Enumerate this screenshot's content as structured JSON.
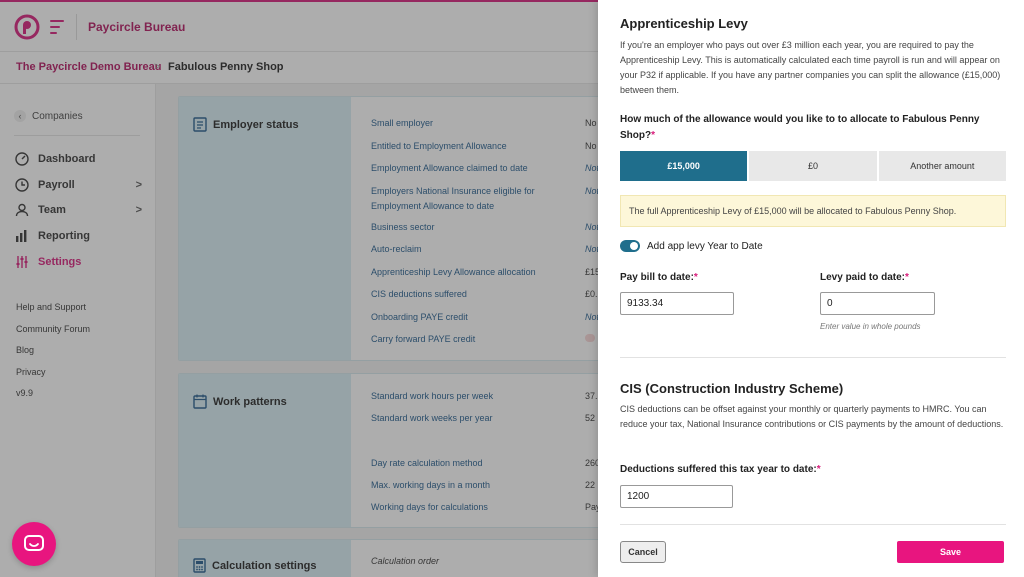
{
  "app": {
    "name": "Paycircle Bureau",
    "brand_color": "#d81b7a",
    "logo_icon": "paycircle-logo",
    "menu_icon": "hamburger-menu-icon"
  },
  "breadcrumb": {
    "parent": "The Paycircle Demo Bureau",
    "separator": ">",
    "current": "Fabulous Penny Shop"
  },
  "sidebar": {
    "back_label": "Companies",
    "items": [
      {
        "label": "Dashboard",
        "icon": "gauge-icon",
        "chevron": ""
      },
      {
        "label": "Payroll",
        "icon": "clock-icon",
        "chevron": ">"
      },
      {
        "label": "Team",
        "icon": "person-icon",
        "chevron": ">"
      },
      {
        "label": "Reporting",
        "icon": "bar-chart-icon",
        "chevron": ""
      },
      {
        "label": "Settings",
        "icon": "sliders-icon",
        "chevron": ""
      }
    ],
    "links": [
      "Help and Support",
      "Community Forum",
      "Blog",
      "Privacy",
      "v9.9"
    ]
  },
  "employer_status": {
    "title": "Employer status",
    "rows": [
      {
        "label": "Small employer",
        "value": "No"
      },
      {
        "label": "Entitled to Employment Allowance",
        "value": "No"
      },
      {
        "label": "Employment Allowance claimed to date",
        "value": "Not"
      },
      {
        "label": "Employers National Insurance eligible for",
        "label2": "Employment Allowance to date",
        "value": "Not"
      },
      {
        "label": "Business sector",
        "value": "Not"
      },
      {
        "label": "Auto-reclaim",
        "value": "Not"
      },
      {
        "label": "Apprenticeship Levy Allowance allocation",
        "value": "£15"
      },
      {
        "label": "CIS deductions suffered",
        "value": "£0."
      },
      {
        "label": "Onboarding PAYE credit",
        "value": "Not"
      },
      {
        "label": "Carry forward PAYE credit",
        "value": ""
      }
    ]
  },
  "work_patterns": {
    "title": "Work patterns",
    "rows": [
      {
        "label": "Standard work hours per week",
        "value": "37."
      },
      {
        "label": "Standard work weeks per year",
        "value": "52"
      },
      {
        "label": "Day rate calculation method",
        "value": "260"
      },
      {
        "label": "Max. working days in a month",
        "value": "22"
      },
      {
        "label": "Working days for calculations",
        "value": "Pay"
      }
    ]
  },
  "calculation_settings": {
    "title": "Calculation settings",
    "first_row": "Calculation order"
  },
  "drawer": {
    "title": "Apprenticeship Levy",
    "intro": "If you're an employer who pays out over £3 million each year, you are required to pay the Apprenticeship Levy. This is automatically calculated each time payroll is run and will appear on your P32 if applicable. If you have any partner companies you can split the allowance (£15,000) between them.",
    "question": "How much of the allowance would you like to to allocate to Fabulous Penny Shop?",
    "required_mark": "*",
    "options": [
      {
        "label": "£15,000",
        "selected": true
      },
      {
        "label": "£0",
        "selected": false
      },
      {
        "label": "Another amount",
        "selected": false
      }
    ],
    "notice": "The full Apprenticeship Levy of £15,000 will be allocated to Fabulous Penny Shop.",
    "toggle_label": "Add app levy Year to Date",
    "toggle_on": true,
    "pay_bill_label": "Pay bill to date:",
    "pay_bill_value": "9133.34",
    "levy_paid_label": "Levy paid to date:",
    "levy_paid_value": "0",
    "levy_hint": "Enter value in whole pounds",
    "cis_title": "CIS (Construction Industry Scheme)",
    "cis_text": "CIS deductions can be offset against your monthly or quarterly payments to HMRC. You can reduce your tax, National Insurance contributions or CIS payments by the amount of deductions.",
    "deductions_label": "Deductions suffered this tax year to date:",
    "deductions_value": "1200",
    "cancel_label": "Cancel",
    "save_label": "Save"
  },
  "chat_icon": "chat-bubble-icon"
}
